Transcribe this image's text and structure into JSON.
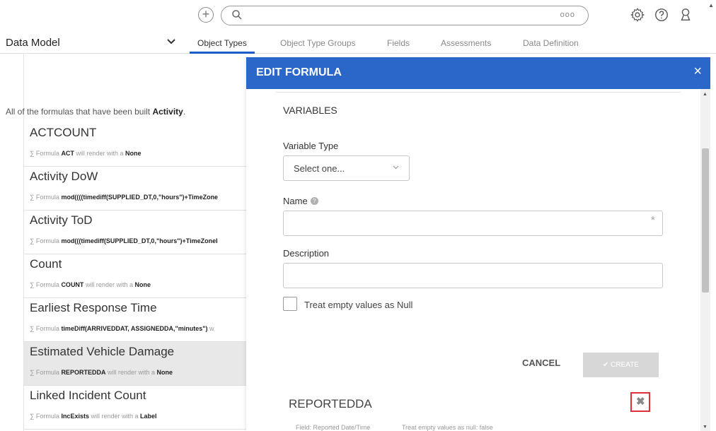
{
  "topbar": {
    "search_more": "ooo"
  },
  "nav": {
    "data_model_label": "Data Model",
    "tabs": [
      {
        "label": "Object Types",
        "active": true
      },
      {
        "label": "Object Type Groups",
        "active": false
      },
      {
        "label": "Fields",
        "active": false
      },
      {
        "label": "Assessments",
        "active": false
      },
      {
        "label": "Data Definition",
        "active": false
      }
    ]
  },
  "formulas": {
    "intro_prefix": "All of the formulas that have been built ",
    "intro_object": "Activity",
    "intro_suffix": ".",
    "items": [
      {
        "title": "ACTCOUNT",
        "sub_prefix": "∑ Formula ",
        "expr": "ACT",
        "sub_mid": " will render with a ",
        "render": "None"
      },
      {
        "title": "Activity DoW",
        "sub_prefix": "∑ Formula ",
        "expr": "mod((((timediff(SUPPLIED_DT,0,\"hours\")+TimeZone",
        "sub_mid": "",
        "render": ""
      },
      {
        "title": "Activity ToD",
        "sub_prefix": "∑ Formula ",
        "expr": "mod(((timediff(SUPPLIED_DT,0,\"hours\")+TimeZoneI",
        "sub_mid": "",
        "render": ""
      },
      {
        "title": "Count",
        "sub_prefix": "∑ Formula ",
        "expr": "COUNT",
        "sub_mid": " will render with a ",
        "render": "None"
      },
      {
        "title": "Earliest Response Time",
        "sub_prefix": "∑ Formula ",
        "expr": "timeDiff(ARRIVEDDAT, ASSIGNEDDA,\"minutes\")",
        "sub_mid": " w",
        "render": ""
      },
      {
        "title": "Estimated Vehicle Damage",
        "sub_prefix": "∑ Formula ",
        "expr": "REPORTEDDA",
        "sub_mid": " will render with a ",
        "render": "None"
      },
      {
        "title": "Linked Incident Count",
        "sub_prefix": "∑ Formula ",
        "expr": "IncExists",
        "sub_mid": " will render with a ",
        "render": "Label"
      }
    ]
  },
  "modal": {
    "title": "EDIT FORMULA",
    "close": "×",
    "section_title": "VARIABLES",
    "variable_type_label": "Variable Type",
    "variable_type_value": "Select one...",
    "name_label": "Name",
    "name_help": "?",
    "name_required": "*",
    "name_value": "",
    "description_label": "Description",
    "description_value": "",
    "null_checkbox_label": "Treat empty values as Null",
    "null_checked": false,
    "cancel_label": "CANCEL",
    "create_label": "✔ CREATE",
    "variable": {
      "name": "REPORTEDDA",
      "delete_icon": "✖",
      "field_meta": "Field: Reported Date/Time",
      "null_meta": "Treat empty values as null: false"
    }
  }
}
